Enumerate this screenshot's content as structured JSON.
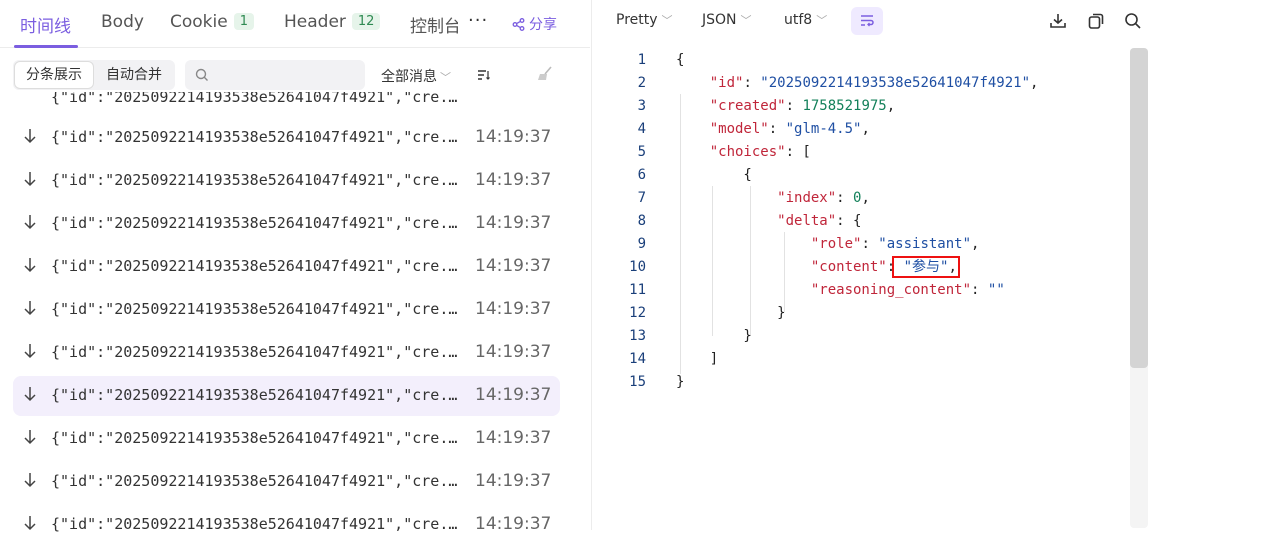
{
  "left": {
    "tabs": [
      {
        "label": "时间线"
      },
      {
        "label": "Body"
      },
      {
        "label": "Cookie",
        "badge": "1"
      },
      {
        "label": "Header",
        "badge": "12"
      },
      {
        "label": "控制台"
      }
    ],
    "share_label": "分享",
    "more_label": "···",
    "toolbar": {
      "split_label": "分条展示",
      "merge_label": "自动合并",
      "search_placeholder": "",
      "filter_label": "全部消息"
    },
    "rows": [
      {
        "msg": "{\"id\":\"2025092214193538e52641047f4921\",\"cre...",
        "time": "14:19:37"
      },
      {
        "msg": "{\"id\":\"2025092214193538e52641047f4921\",\"cre...",
        "time": "14:19:37"
      },
      {
        "msg": "{\"id\":\"2025092214193538e52641047f4921\",\"cre...",
        "time": "14:19:37"
      },
      {
        "msg": "{\"id\":\"2025092214193538e52641047f4921\",\"cre...",
        "time": "14:19:37"
      },
      {
        "msg": "{\"id\":\"2025092214193538e52641047f4921\",\"cre...",
        "time": "14:19:37"
      },
      {
        "msg": "{\"id\":\"2025092214193538e52641047f4921\",\"cre...",
        "time": "14:19:37"
      },
      {
        "msg": "{\"id\":\"2025092214193538e52641047f4921\",\"cre...",
        "time": "14:19:37",
        "selected": true
      },
      {
        "msg": "{\"id\":\"2025092214193538e52641047f4921\",\"cre...",
        "time": "14:19:37"
      },
      {
        "msg": "{\"id\":\"2025092214193538e52641047f4921\",\"cre...",
        "time": "14:19:37"
      },
      {
        "msg": "{\"id\":\"2025092214193538e52641047f4921\",\"cre...",
        "time": "14:19:37"
      }
    ]
  },
  "right": {
    "format_label": "Pretty",
    "type_label": "JSON",
    "encoding_label": "utf8",
    "json": {
      "id": "2025092214193538e52641047f4921",
      "created": "1758521975",
      "model": "glm-4.5",
      "index": "0",
      "role": "assistant",
      "content": "参与",
      "reasoning_content": ""
    }
  },
  "colors": {
    "accent": "#7b5ee0",
    "selected_row": "#f3effc",
    "json_key": "#c0263a",
    "json_string": "#1f4fa3",
    "json_number": "#13805a",
    "highlight_box": "#e11111"
  }
}
